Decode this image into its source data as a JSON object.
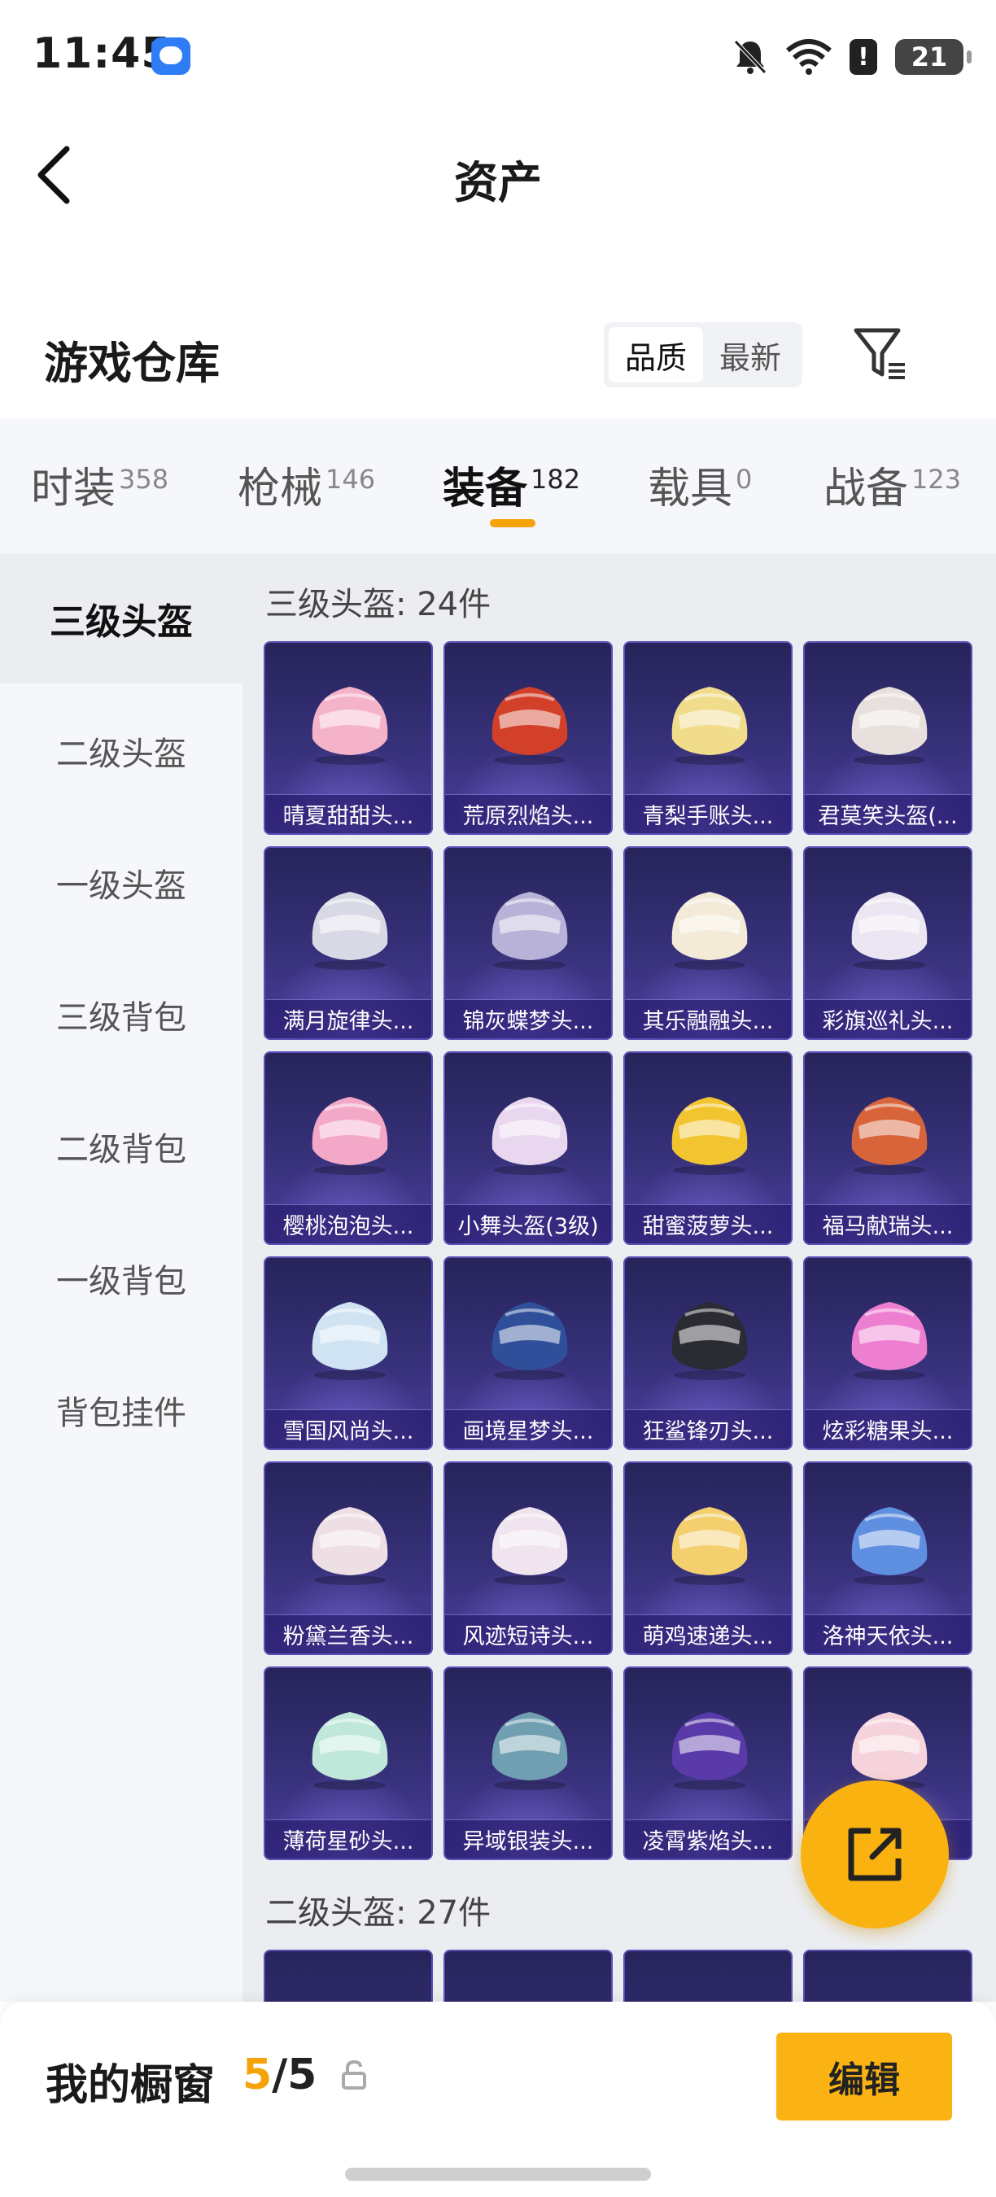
{
  "status_bar": {
    "time": "11:45",
    "battery": "21",
    "alert": "!"
  },
  "header": {
    "title": "资产"
  },
  "warehouse": {
    "title": "游戏仓库",
    "sort_options": [
      "品质",
      "最新"
    ],
    "active_sort": "品质"
  },
  "tabs": [
    {
      "label": "时装",
      "count": "358"
    },
    {
      "label": "枪械",
      "count": "146"
    },
    {
      "label": "装备",
      "count": "182"
    },
    {
      "label": "载具",
      "count": "0"
    },
    {
      "label": "战备",
      "count": "123"
    }
  ],
  "active_tab": "装备",
  "sidebar": {
    "items": [
      "三级头盔",
      "二级头盔",
      "一级头盔",
      "三级背包",
      "二级背包",
      "一级背包",
      "背包挂件"
    ],
    "active": "三级头盔"
  },
  "sections": [
    {
      "title": "三级头盔: 24件",
      "items": [
        {
          "name": "晴夏甜甜头...",
          "color": "#f4b3c9"
        },
        {
          "name": "荒原烈焰头...",
          "color": "#d2402a"
        },
        {
          "name": "青梨手账头...",
          "color": "#f0dc8a"
        },
        {
          "name": "君莫笑头盔(...",
          "color": "#e8e0dc"
        },
        {
          "name": "满月旋律头...",
          "color": "#d9d9e6"
        },
        {
          "name": "锦灰蝶梦头...",
          "color": "#b8b2d8"
        },
        {
          "name": "其乐融融头...",
          "color": "#f3ead8"
        },
        {
          "name": "彩旗巡礼头...",
          "color": "#ebe6f2"
        },
        {
          "name": "樱桃泡泡头...",
          "color": "#f3a8c8"
        },
        {
          "name": "小舞头盔(3级)",
          "color": "#e9d7ef"
        },
        {
          "name": "甜蜜菠萝头...",
          "color": "#f2c530"
        },
        {
          "name": "福马献瑞头...",
          "color": "#d8643a"
        },
        {
          "name": "雪国风尚头...",
          "color": "#cfe3f2"
        },
        {
          "name": "画境星梦头...",
          "color": "#2f4f9a"
        },
        {
          "name": "狂鲨锋刃头...",
          "color": "#2b2b33"
        },
        {
          "name": "炫彩糖果头...",
          "color": "#ee7fd0"
        },
        {
          "name": "粉黛兰香头...",
          "color": "#eedfe4"
        },
        {
          "name": "风迹短诗头...",
          "color": "#f0e4ee"
        },
        {
          "name": "萌鸡速递头...",
          "color": "#f4cf6e"
        },
        {
          "name": "洛神天依头...",
          "color": "#5f8fe0"
        },
        {
          "name": "薄荷星砂头...",
          "color": "#bfe8da"
        },
        {
          "name": "异域银装头...",
          "color": "#6f9fb0"
        },
        {
          "name": "凌霄紫焰头...",
          "color": "#5a3aa8"
        },
        {
          "name": "",
          "color": "#f6d3dc"
        }
      ]
    },
    {
      "title": "二级头盔: 27件",
      "items": []
    }
  ],
  "showcase": {
    "label": "我的橱窗",
    "current": "5",
    "total": "/5",
    "edit_label": "编辑"
  }
}
